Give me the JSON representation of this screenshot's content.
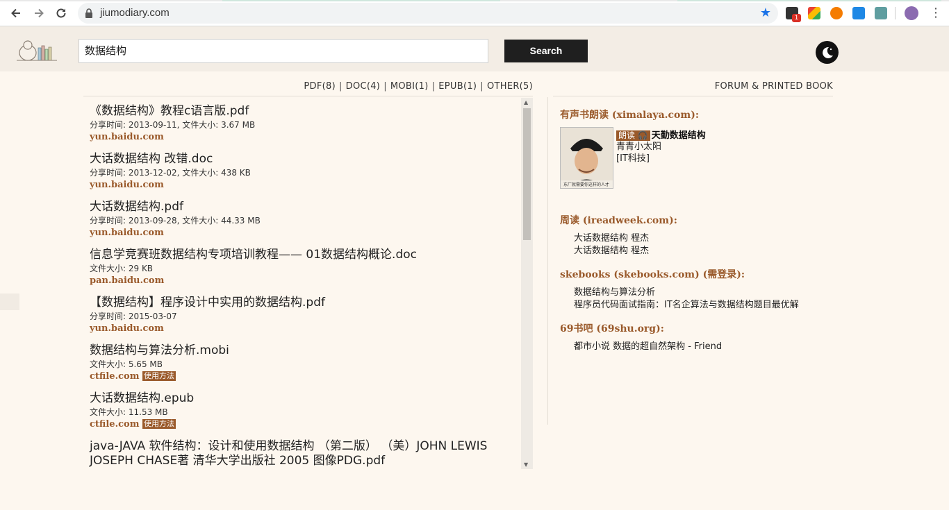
{
  "browser": {
    "url": "jiumodiary.com",
    "extension_badge": "1"
  },
  "header": {
    "search_value": "数据结构",
    "search_button": "Search"
  },
  "filters": {
    "pdf": "PDF(8)",
    "doc": "DOC(4)",
    "mobi": "MOBI(1)",
    "epub": "EPUB(1)",
    "other": "OTHER(5)",
    "separator": "|"
  },
  "results": [
    {
      "title": "《数据结构》教程c语言版.pdf",
      "meta": "分享时间: 2013-09-11, 文件大小: 3.67 MB",
      "source": "yun.baidu.com"
    },
    {
      "title": "大话数据结构 改错.doc",
      "meta": "分享时间: 2013-12-02, 文件大小: 438 KB",
      "source": "yun.baidu.com"
    },
    {
      "title": "大话数据结构.pdf",
      "meta": "分享时间: 2013-09-28, 文件大小: 44.33 MB",
      "source": "yun.baidu.com"
    },
    {
      "title": "信息学竞赛班数据结构专项培训教程—— 01数据结构概论.doc",
      "meta": "文件大小: 29 KB",
      "source": "pan.baidu.com"
    },
    {
      "title": "【数据结构】程序设计中实用的数据结构.pdf",
      "meta": "分享时间: 2015-03-07",
      "source": "yun.baidu.com"
    },
    {
      "title": "数据结构与算法分析.mobi",
      "meta": "文件大小: 5.65 MB",
      "source": "ctfile.com",
      "howto": "使用方法"
    },
    {
      "title": "大话数据结构.epub",
      "meta": "文件大小: 11.53 MB",
      "source": "ctfile.com",
      "howto": "使用方法"
    },
    {
      "title": "java-JAVA 软件结构：设计和使用数据结构 （第二版） （美）JOHN LEWIS JOSEPH CHASE著 清华大学出版社 2005 图像PDG.pdf"
    }
  ],
  "right": {
    "forum_link": "FORUM & PRINTED BOOK",
    "ximalaya": {
      "title": "有声书朗读 (ximalaya.com):",
      "tag": "朗读",
      "book": "天勤数据结构",
      "author": "青青小太阳",
      "category": "[IT科技]",
      "cover_caption": "东厂就需要你这样的人才"
    },
    "ireadweek": {
      "title": "周读 (ireadweek.com):",
      "items": [
        "大话数据结构 程杰",
        "大话数据结构 程杰"
      ]
    },
    "skebooks": {
      "title": "skebooks (skebooks.com) (需登录):",
      "items": [
        "数据结构与算法分析",
        "程序员代码面试指南：IT名企算法与数据结构题目最优解"
      ]
    },
    "shu69": {
      "title": "69书吧 (69shu.org):",
      "items": [
        "都市小说 数据的超自然架构 - Friend"
      ]
    }
  }
}
